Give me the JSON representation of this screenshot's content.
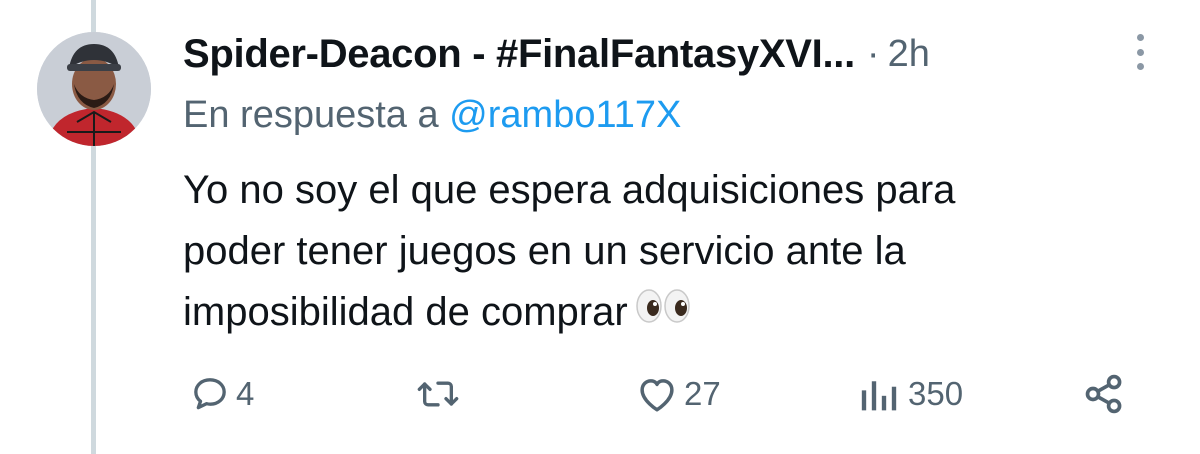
{
  "tweet": {
    "display_name": "Spider-Deacon - #FinalFantasyXVI...",
    "separator": "·",
    "time": "2h",
    "reply_prefix": "En respuesta a",
    "reply_handle": "@rambo117X",
    "text_lines": [
      "Yo no soy el que espera adquisiciones para",
      "poder tener juegos en un servicio ante la",
      "imposibilidad de comprar"
    ],
    "emoji": "eyes",
    "stats": {
      "replies": "4",
      "likes": "27",
      "views": "350"
    }
  },
  "icons": [
    "more-options-icon",
    "reply-icon",
    "retweet-icon",
    "like-icon",
    "views-icon",
    "share-icon"
  ],
  "colors": {
    "text": "#0f1419",
    "secondary": "#536471",
    "link": "#1d9bf0",
    "thread_line": "#cfd9de"
  }
}
